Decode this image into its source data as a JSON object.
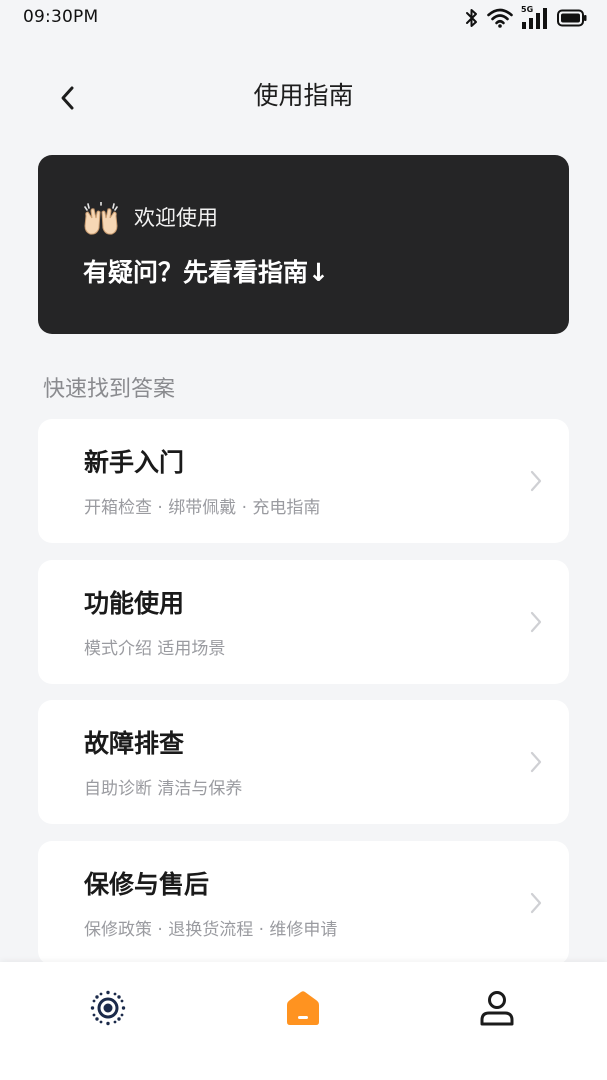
{
  "status_bar": {
    "time": "09:30PM",
    "network": "5G"
  },
  "header": {
    "title": "使用指南"
  },
  "banner": {
    "welcome": "欢迎使用",
    "headline": "有疑问？先看看指南↓",
    "background_color": "#252526"
  },
  "section": {
    "label": "快速找到答案"
  },
  "cards": [
    {
      "title": "新手入门",
      "subtitle": "开箱检查 · 绑带佩戴 · 充电指南"
    },
    {
      "title": "功能使用",
      "subtitle": "模式介绍 适用场景"
    },
    {
      "title": "故障排查",
      "subtitle": "自助诊断 清洁与保养"
    },
    {
      "title": "保修与售后",
      "subtitle": "保修政策 · 退换货流程 · 维修申请"
    }
  ],
  "bottom_nav": {
    "items": [
      {
        "icon": "device-icon",
        "active": false
      },
      {
        "icon": "home-icon",
        "active": true
      },
      {
        "icon": "profile-icon",
        "active": false
      }
    ],
    "accent_color": "#ff9320"
  }
}
